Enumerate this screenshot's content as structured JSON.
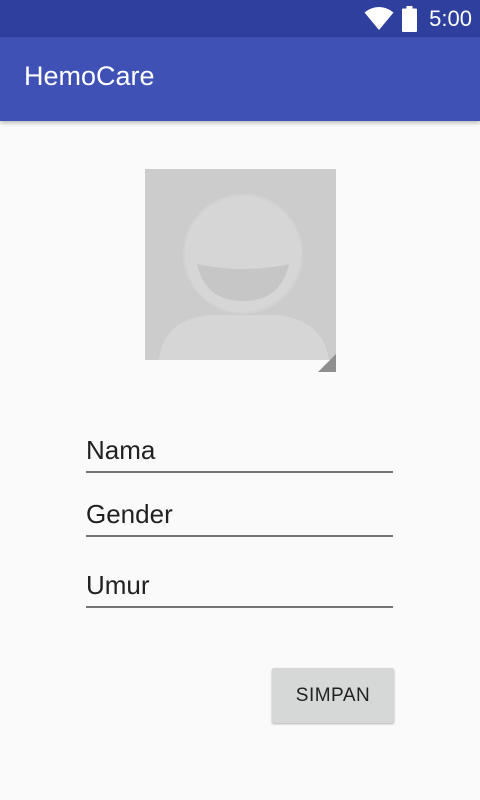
{
  "status_bar": {
    "time": "5:00",
    "icons": [
      "wifi-icon",
      "battery-icon"
    ]
  },
  "app_bar": {
    "title": "HemoCare"
  },
  "profile": {
    "avatar_icon": "person-placeholder-icon"
  },
  "form": {
    "nama": "Nama",
    "gender": "Gender",
    "umur": "Umur"
  },
  "actions": {
    "save_label": "SIMPAN"
  },
  "colors": {
    "status_bar": "#2f3f9e",
    "app_bar": "#3f51b5",
    "background": "#fafafa",
    "button": "#d6d7d7"
  }
}
